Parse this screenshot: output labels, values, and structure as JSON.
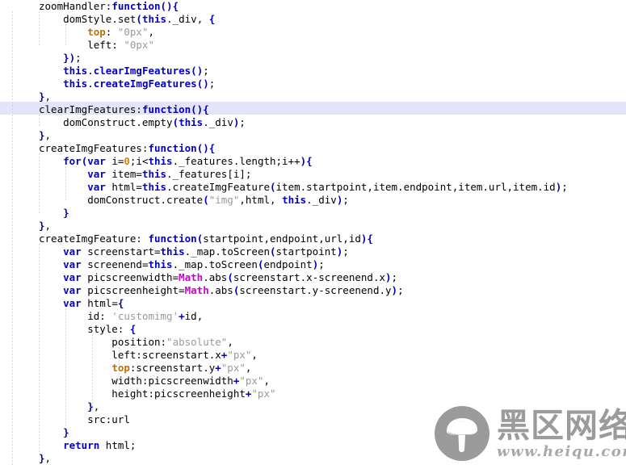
{
  "editor": {
    "background_color": "#ffffff",
    "current_line_highlight_color": "#e4e4f8",
    "indent_guide_color": "#c9c9c9",
    "font_size_px": 12.5,
    "line_height_px": 16,
    "highlighted_line_number": 8,
    "syntax_colors": {
      "keyword": "#0000d0",
      "string": "#9a9a9a",
      "number": "#d78500",
      "class": "#cc00cc",
      "css_property": "#c07000",
      "plain": "#000000"
    },
    "lines": [
      "zoomHandler:function(){",
      "    domStyle.set(this._div, {",
      "        top: \"0px\",",
      "        left: \"0px\"",
      "    });",
      "    this.clearImgFeatures();",
      "    this.createImgFeatures();",
      "},",
      "clearImgFeatures:function(){",
      "    domConstruct.empty(this._div);",
      "},",
      "createImgFeatures:function(){",
      "    for(var i=0;i<this._features.length;i++){",
      "        var item=this._features[i];",
      "        var html=this.createImgFeature(item.startpoint,item.endpoint,item.url,item.id);",
      "        domConstruct.create(\"img\",html, this._div);",
      "    }",
      "},",
      "createImgFeature: function(startpoint,endpoint,url,id){",
      "    var screenstart=this._map.toScreen(startpoint);",
      "    var screenend=this._map.toScreen(endpoint);",
      "    var picscreenwidth=Math.abs(screenstart.x-screenend.x);",
      "    var picscreenheight=Math.abs(screenstart.y-screenend.y);",
      "    var html={",
      "        id: 'customimg'+id,",
      "        style: {",
      "            position:\"absolute\",",
      "            left:screenstart.x+\"px\",",
      "            top:screenstart.y+\"px\",",
      "            width:picscreenwidth+\"px\",",
      "            height:picscreenheight+\"px\"",
      "        },",
      "        src:url",
      "    }",
      "    return html;",
      "},"
    ]
  },
  "watermark": {
    "logo_icon": "mushroom-icon",
    "chinese_text": "黑区网络",
    "url_text": "www.heiqu.com",
    "color": "#9b9b9b"
  }
}
